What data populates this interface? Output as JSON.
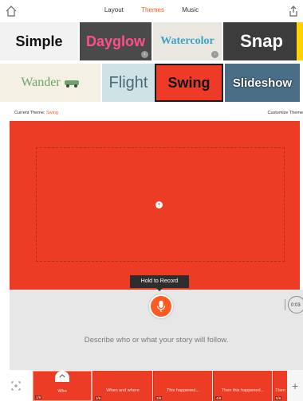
{
  "nav": {
    "tabs": [
      {
        "label": "Layout"
      },
      {
        "label": "Themes"
      },
      {
        "label": "Music"
      }
    ],
    "active_tab": "Themes"
  },
  "themes": [
    {
      "label": "Simple"
    },
    {
      "label": "Dayglow"
    },
    {
      "label": "Watercolor"
    },
    {
      "label": "Snap"
    },
    {
      "label": "Wander"
    },
    {
      "label": "Flight"
    },
    {
      "label": "Swing"
    },
    {
      "label": "Slideshow"
    }
  ],
  "theme_info": {
    "current_label": "Current Theme:",
    "current_value": "Swing",
    "customize_label": "Customize Theme"
  },
  "record": {
    "tooltip": "Hold to Record",
    "timer": "0:03",
    "prompt": "Describe who or what your story will follow."
  },
  "slides": [
    {
      "caption": "Who",
      "tag": "1/6"
    },
    {
      "caption": "When and where",
      "tag": "2/6"
    },
    {
      "caption": "This happened...",
      "tag": "3/6"
    },
    {
      "caption": "Then this happened...",
      "tag": "4/6"
    },
    {
      "caption": "Then",
      "tag": "5/6"
    }
  ],
  "colors": {
    "accent": "#ff5a1f",
    "slide_red": "#ec3c25"
  }
}
